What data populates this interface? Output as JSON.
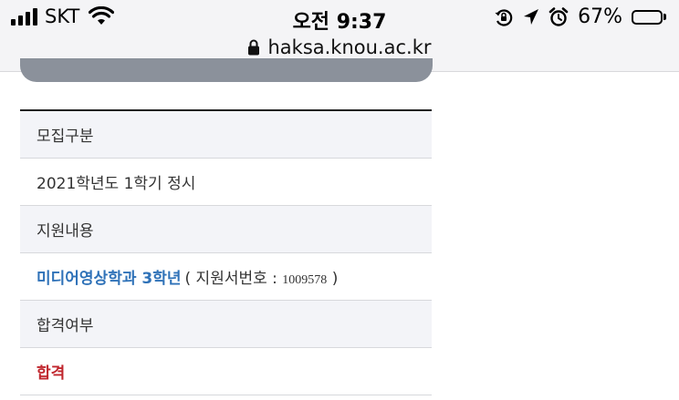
{
  "status_bar": {
    "carrier": "SKT",
    "time": "오전 9:37",
    "battery_percent": "67%",
    "battery_level": 0.67,
    "icons": [
      "signal-icon",
      "wifi-icon",
      "rotation-lock-icon",
      "location-arrow-icon",
      "alarm-icon",
      "battery-icon"
    ]
  },
  "browser": {
    "url": "haksa.knou.ac.kr"
  },
  "result_table": {
    "recruit_type_label": "모집구분",
    "recruit_type_value": "2021학년도 1학기 정시",
    "application_label": "지원내용",
    "department": "미디어영상학과 3학년",
    "application_number_prefix": "( 지원서번호 : ",
    "application_number": "1009578",
    "application_number_suffix": " )",
    "pass_label": "합격여부",
    "pass_value": "합격"
  },
  "colors": {
    "department_link": "#2f72b8",
    "pass": "#c0262d",
    "header_row_bg": "#f3f4f8"
  }
}
